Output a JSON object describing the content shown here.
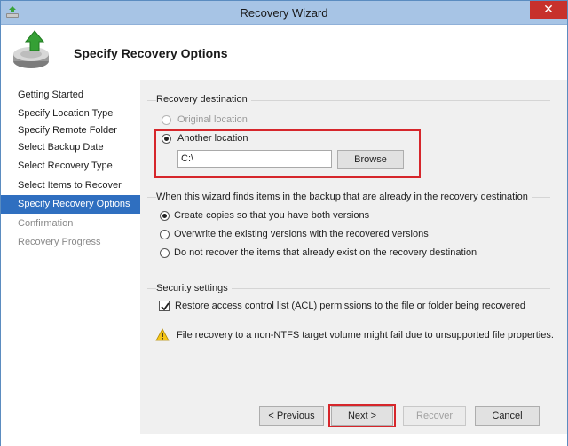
{
  "window": {
    "title": "Recovery Wizard",
    "close_label": "✕"
  },
  "header": {
    "title": "Specify Recovery Options"
  },
  "sidebar": {
    "steps": [
      {
        "label": "Getting Started",
        "state": "done"
      },
      {
        "label": "Specify Location Type",
        "state": "done"
      },
      {
        "label": "Specify Remote Folder",
        "state": "done"
      },
      {
        "label": "Select Backup Date",
        "state": "done"
      },
      {
        "label": "Select Recovery Type",
        "state": "done"
      },
      {
        "label": "Select Items to Recover",
        "state": "done"
      },
      {
        "label": "Specify Recovery Options",
        "state": "active"
      },
      {
        "label": "Confirmation",
        "state": "pending"
      },
      {
        "label": "Recovery Progress",
        "state": "pending"
      }
    ]
  },
  "destination": {
    "group_label": "Recovery destination",
    "original_label": "Original location",
    "another_label": "Another location",
    "path_value": "C:\\",
    "browse_label": "Browse"
  },
  "conflict": {
    "group_label": "When this wizard finds items in the backup that are already in the recovery destination",
    "options": [
      "Create copies so that you have both versions",
      "Overwrite the existing versions with the recovered versions",
      "Do not recover the items that already exist on the recovery destination"
    ]
  },
  "security": {
    "group_label": "Security settings",
    "acl_label": "Restore access control list (ACL) permissions to the file or folder being recovered"
  },
  "warning": {
    "text": "File recovery to a non-NTFS target volume might fail due to unsupported file properties."
  },
  "footer": {
    "previous_label": "< Previous",
    "next_label": "Next >",
    "recover_label": "Recover",
    "cancel_label": "Cancel"
  },
  "colors": {
    "accent": "#2f6fc0",
    "highlight": "#d6262b",
    "titlebar": "#a7c4e5"
  }
}
